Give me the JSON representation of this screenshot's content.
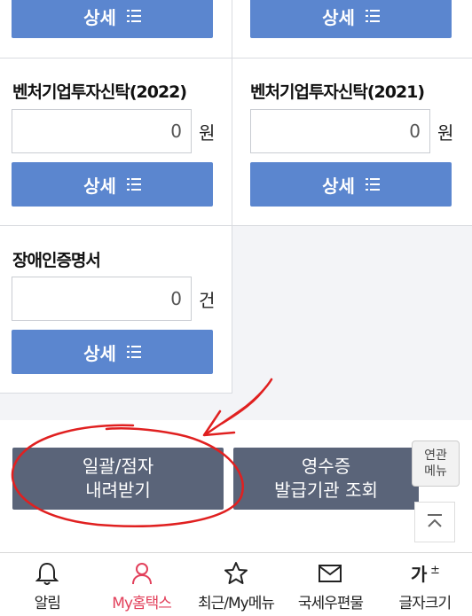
{
  "unit_won": "원",
  "unit_count": "건",
  "detail_label": "상세",
  "cells": [
    {
      "title": "",
      "value": "",
      "unit": ""
    },
    {
      "title": "",
      "value": "",
      "unit": ""
    },
    {
      "title": "벤처기업투자신탁(2022)",
      "value": "0",
      "unit": "원"
    },
    {
      "title": "벤처기업투자신탁(2021)",
      "value": "0",
      "unit": "원"
    },
    {
      "title": "장애인증명서",
      "value": "0",
      "unit": "건"
    }
  ],
  "actions": {
    "bulk_download_line1": "일괄/점자",
    "bulk_download_line2": "내려받기",
    "receipt_line1": "영수증",
    "receipt_line2": "발급기관 조회"
  },
  "related_menu": {
    "line1": "연관",
    "line2": "메뉴"
  },
  "tabbar": [
    {
      "label": "알림",
      "icon": "bell-icon",
      "active": false
    },
    {
      "label": "My홈택스",
      "icon": "person-icon",
      "active": true
    },
    {
      "label": "최근/My메뉴",
      "icon": "star-icon",
      "active": false
    },
    {
      "label": "국세우편물",
      "icon": "mail-icon",
      "active": false
    },
    {
      "label": "글자크기",
      "icon": "font-size-icon",
      "active": false
    }
  ],
  "colors": {
    "detail_button": "#5b86cf",
    "action_button": "#5a6479",
    "active_tab": "#e2405b",
    "annotation": "#e02020"
  }
}
